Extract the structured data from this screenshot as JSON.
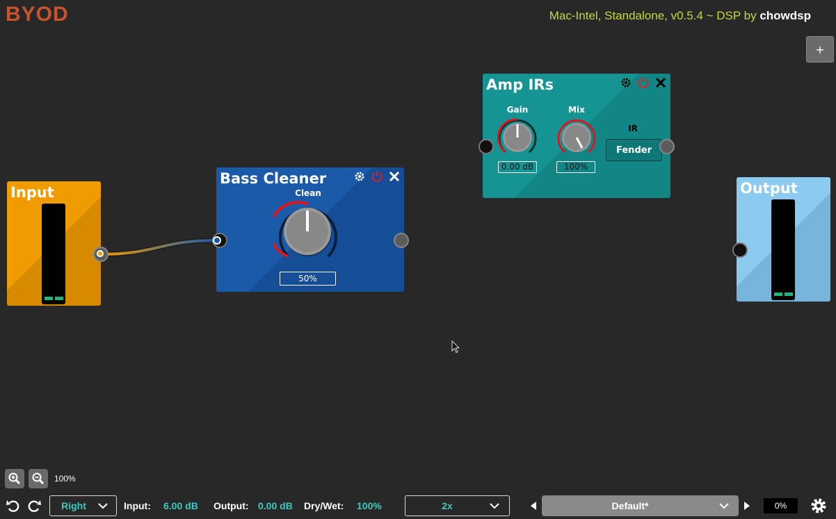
{
  "app": {
    "logo": "BYOD",
    "version_prefix": "Mac-Intel, Standalone, v0.5.4 ~ DSP by ",
    "version_author": "chowdsp",
    "add_button": "+"
  },
  "nodes": {
    "input": {
      "title": "Input",
      "meter_levels": [
        0.04,
        0.04
      ]
    },
    "output": {
      "title": "Output",
      "meter_levels": [
        0.04,
        0.04
      ]
    },
    "bass_cleaner": {
      "title": "Bass Cleaner",
      "param": {
        "label": "Clean",
        "value": "50%",
        "level": 0.5
      }
    },
    "amp_irs": {
      "title": "Amp IRs",
      "gain": {
        "label": "Gain",
        "value": "0.00 dB",
        "level": 0.5
      },
      "mix": {
        "label": "Mix",
        "value": "100%",
        "level": 1.0
      },
      "ir": {
        "label": "IR",
        "value": "Fender"
      }
    }
  },
  "canvas": {
    "zoom": "100%"
  },
  "bottom_bar": {
    "channel": "Right",
    "input_label": "Input:",
    "input_value": "6.00 dB",
    "output_label": "Output:",
    "output_value": "0.00 dB",
    "drywet_label": "Dry/Wet:",
    "drywet_value": "100%",
    "oversampling": "2x",
    "preset": "Default*",
    "cpu": "0%"
  },
  "colors": {
    "accent_teal": "#3fc9c0",
    "logo": "#c9542c",
    "version": "#c9d640",
    "knob_arc": "#e0161c"
  }
}
